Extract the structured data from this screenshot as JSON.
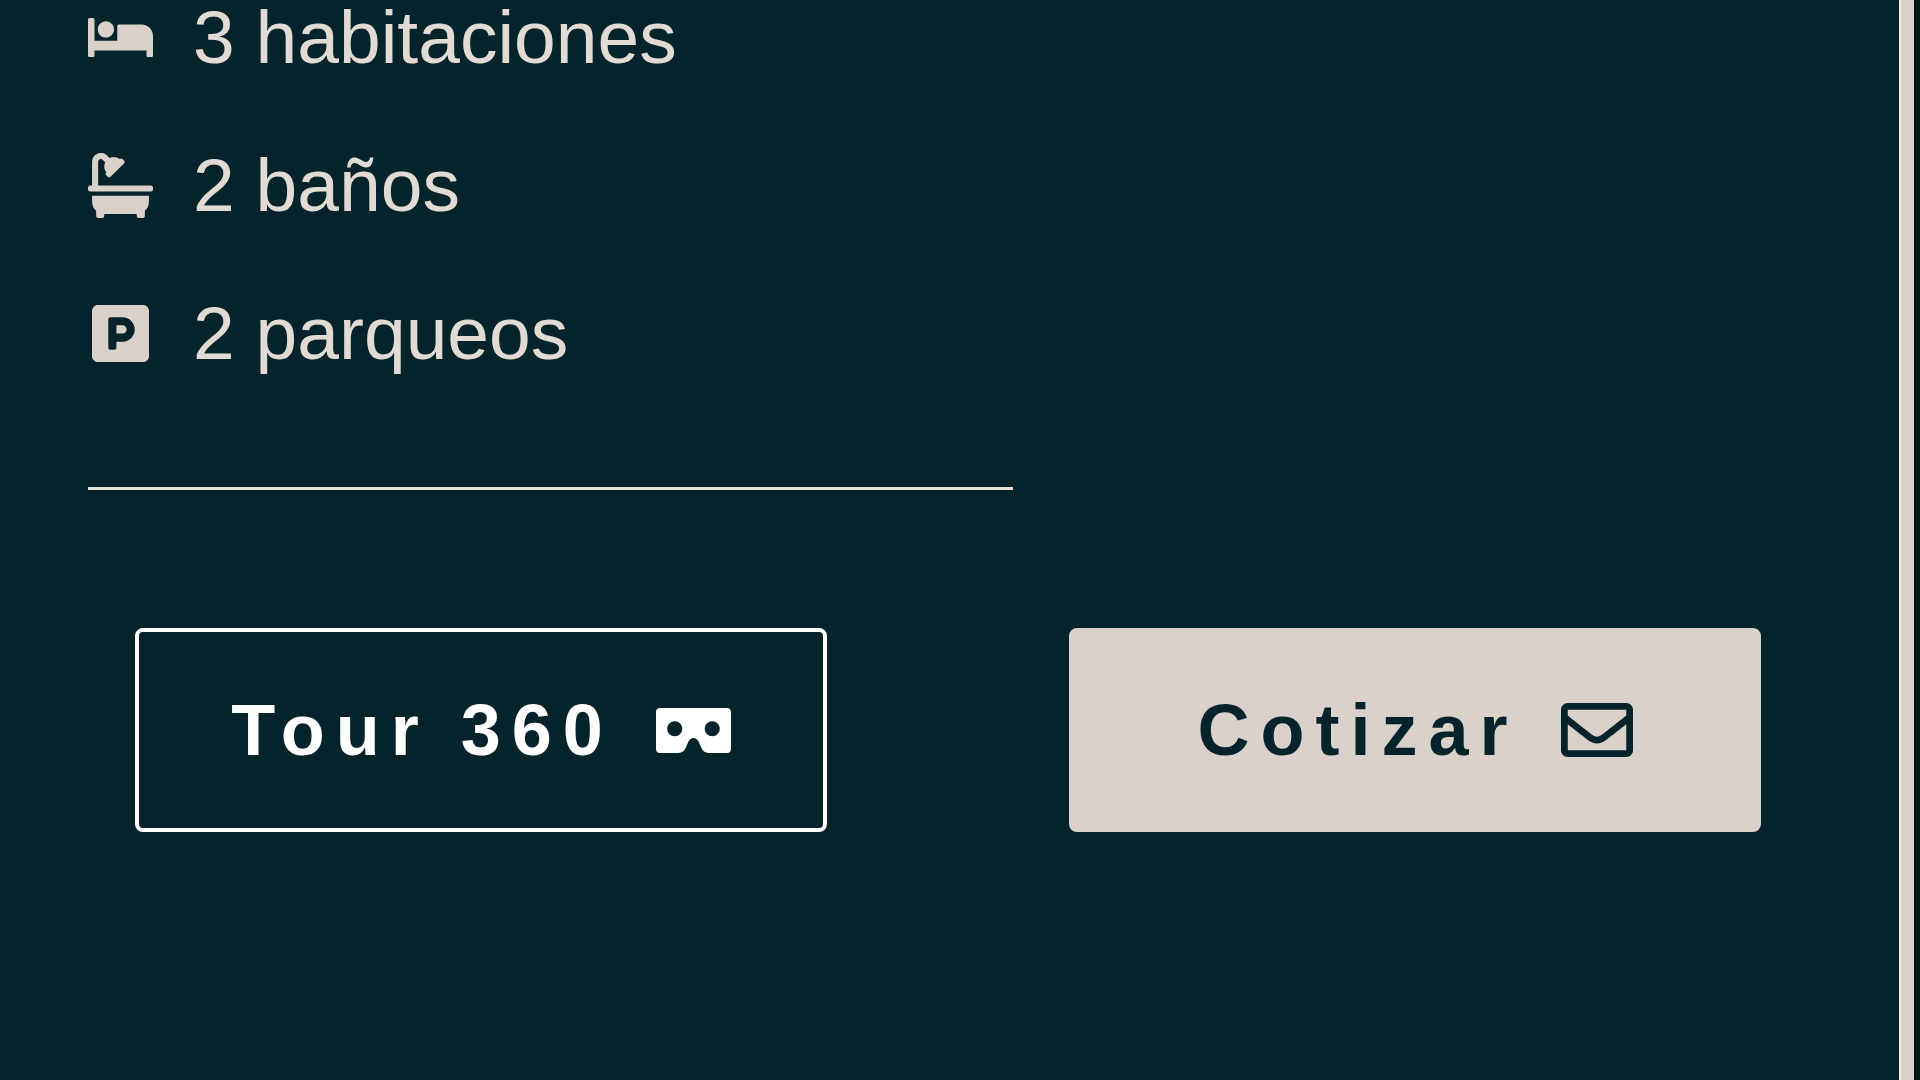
{
  "features": [
    {
      "kind": "bedrooms",
      "label": "3 habitaciones"
    },
    {
      "kind": "bathrooms",
      "label": "2 baños"
    },
    {
      "kind": "parking",
      "label": "2 parqueos"
    }
  ],
  "actions": [
    {
      "kind": "tour",
      "label": "Tour 360"
    },
    {
      "kind": "quote",
      "label": "Cotizar"
    }
  ]
}
